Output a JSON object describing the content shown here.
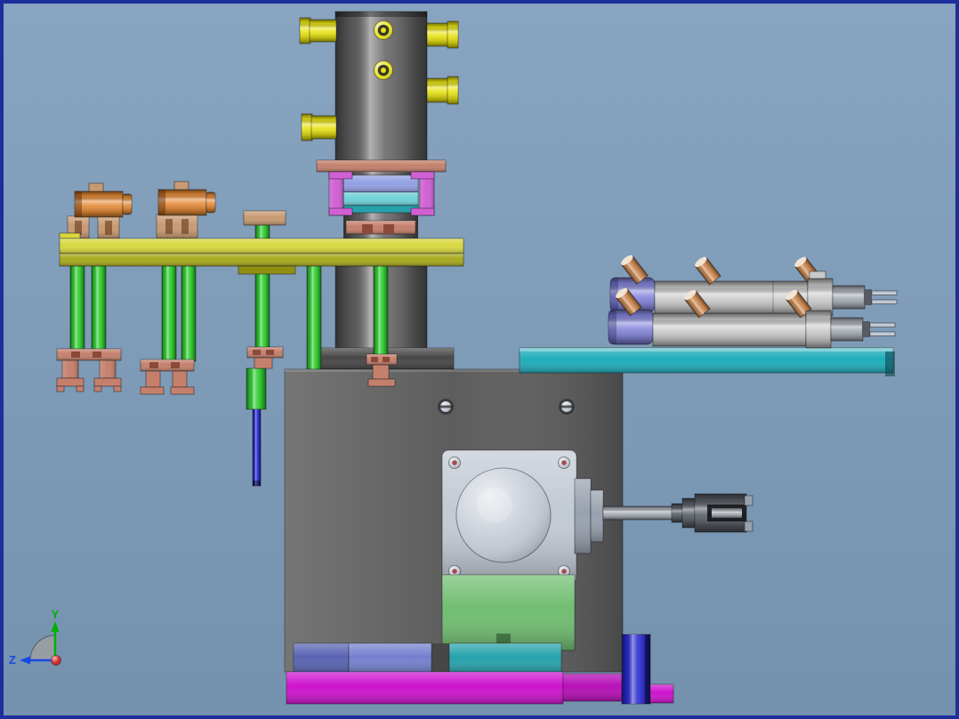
{
  "triad": {
    "y_label": "Y",
    "z_label": "Z"
  },
  "colors": {
    "bg_top": "#88a4c0",
    "bg_bottom": "#7492ae",
    "frame": "#1c2f9c",
    "cyl_gray": "#646464",
    "dark_gray": "#474747",
    "machine_gray": "#5d5d5d",
    "yellow_fitting": "#e8e312",
    "yellow_bar": "#d8d83e",
    "yellow_bar_low": "#a8a81e",
    "olive": "#8f8f14",
    "salmon": "#c5806c",
    "salmon_dark": "#8a4a3a",
    "magenta_bracket": "#d060d4",
    "periwinkle": "#93a0e4",
    "cyan_block": "#6fd2d8",
    "teal_plate": "#1fadbb",
    "teal_block": "#27a2ac",
    "green_rod": "#2ed12e",
    "green_plate": "#70bd70",
    "orange": "#e58a36",
    "tan": "#c89a72",
    "copper": "#d08a50",
    "fitting_cap": "#f2e4d4",
    "blue_cyl": "#8585dc",
    "actuator_gray": "#c9c9c9",
    "shaft_gray": "#a7adb5",
    "connector_gray": "#565b64",
    "silver": "#c2cad4",
    "silver_dark": "#98a1ae",
    "screw_red": "#a34e4e",
    "slate_blue": "#7380ce",
    "slate_blue_dark": "#5963b2",
    "magenta_base": "#ce13ce",
    "deep_blue": "#2a2ad2",
    "triad_gray": "#989da3",
    "axis_y": "#00b000",
    "axis_z": "#1848e8",
    "origin_red": "#cf1616"
  },
  "parts": [
    "pneumatic-cylinder",
    "air-fittings",
    "cylinder-ports",
    "clamp-plate",
    "bracket-stack",
    "tooling-bar",
    "sensor-cylinders",
    "mounting-blocks",
    "guide-rods",
    "gripper-clamps",
    "push-rod",
    "machine-body",
    "cover-screws",
    "servo-motor",
    "motor-mount-plate",
    "motor-shaft",
    "shaft-coupling",
    "green-base-plate",
    "slide-plate",
    "pneumatic-actuators",
    "actuator-fittings",
    "actuator-pins",
    "bottom-blocks",
    "base-plate",
    "support-block",
    "origin-triad"
  ]
}
